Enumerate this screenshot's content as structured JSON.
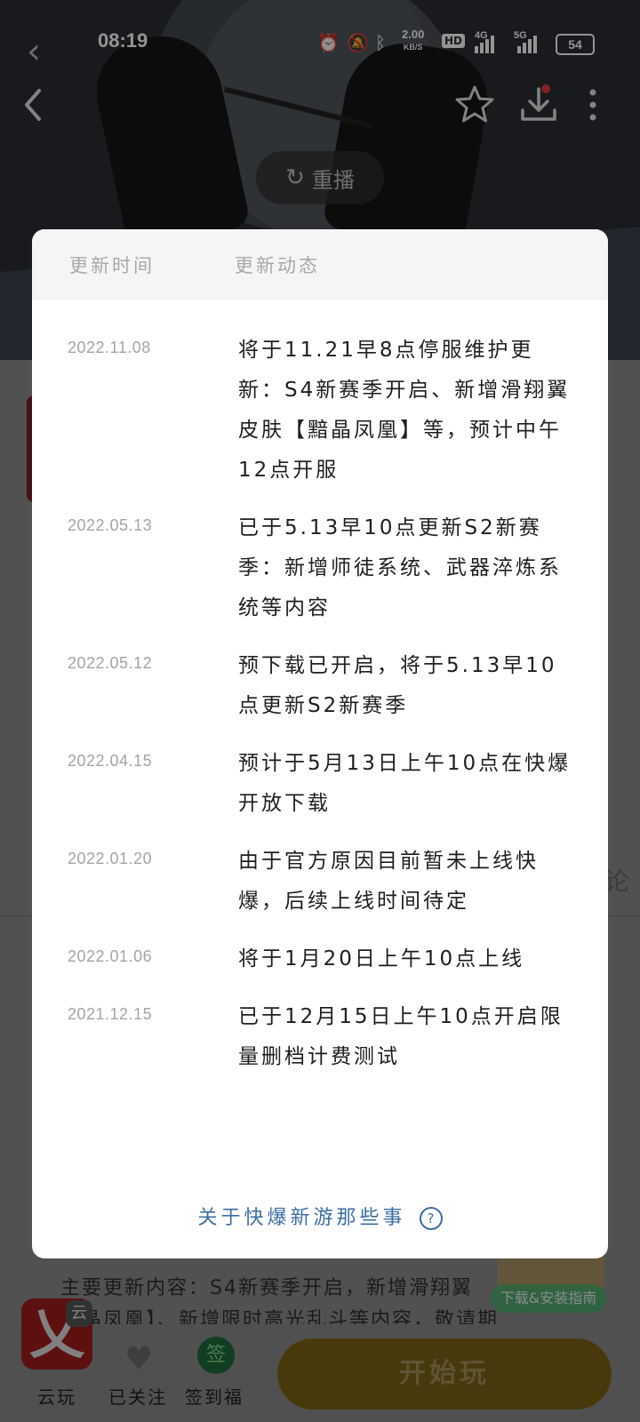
{
  "status_bar": {
    "time": "08:19",
    "speed_value": "2.00",
    "speed_unit": "KB/S",
    "hd_label": "HD",
    "net_4g": "4G",
    "net_5g": "5G",
    "battery": "54",
    "icons": [
      "alarm-icon",
      "mute-icon",
      "bluetooth-icon",
      "signal-icon",
      "battery-icon"
    ]
  },
  "top_nav": {
    "icons": [
      "back-icon",
      "star-icon",
      "download-icon",
      "more-icon"
    ],
    "replay_label": "重播"
  },
  "modal": {
    "header": {
      "time_col": "更新时间",
      "msg_col": "更新动态"
    },
    "rows": [
      {
        "date": "2022.11.08",
        "text": "将于11.21早8点停服维护更新：S4新赛季开启、新增滑翔翼皮肤【黯晶凤凰】等，预计中午12点开服"
      },
      {
        "date": "2022.05.13",
        "text": "已于5.13早10点更新S2新赛季：新增师徒系统、武器淬炼系统等内容"
      },
      {
        "date": "2022.05.12",
        "text": "预下载已开启，将于5.13早10点更新S2新赛季"
      },
      {
        "date": "2022.04.15",
        "text": "预计于5月13日上午10点在快爆开放下载"
      },
      {
        "date": "2022.01.20",
        "text": "由于官方原因目前暂未上线快爆，后续上线时间待定"
      },
      {
        "date": "2022.01.06",
        "text": "将于1月20日上午10点上线"
      },
      {
        "date": "2021.12.15",
        "text": "已于12月15日上午10点开启限量删档计费测试"
      }
    ],
    "about_link": "关于快爆新游那些事",
    "help_glyph": "?"
  },
  "background": {
    "content_line1": "主要更新内容：S4新赛季开启，新增滑翔翼",
    "content_line2": "黯晶凤凰】、新增限时高光乱斗等内容，敬请期",
    "right_text": "论"
  },
  "install_guide": "下载&安装指南",
  "bottom_bar": {
    "cloud_logo_glyph": "乂",
    "cloud_tag": "云",
    "cloud_label": "云玩",
    "follow_label": "已关注",
    "sign_glyph": "签",
    "sign_label": "签到福",
    "start_label": "开始玩"
  }
}
